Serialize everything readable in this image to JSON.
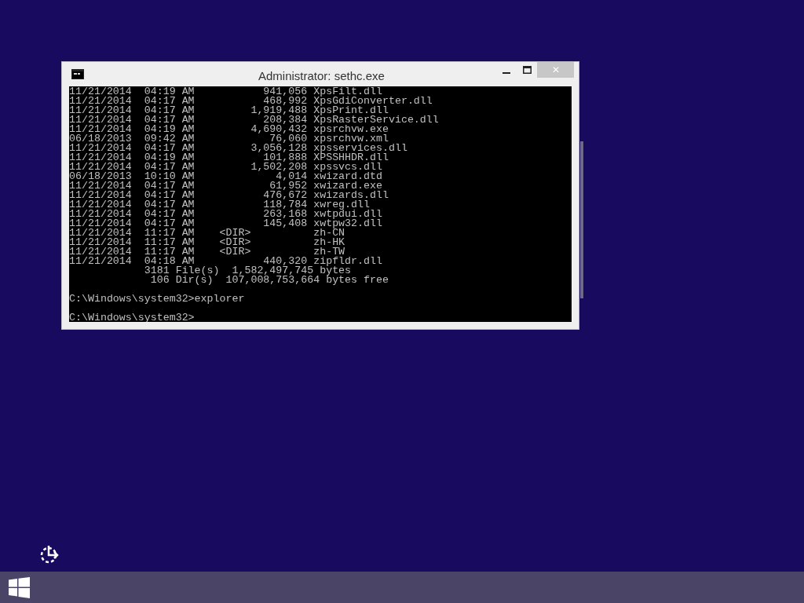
{
  "window": {
    "title": "Administrator: sethc.exe",
    "close_label": "✕"
  },
  "console": {
    "blocks": [
      [
        "11/21/2014  04:19 AM           941,056 XpsFilt.dll",
        "11/21/2014  04:17 AM           468,992 XpsGdiConverter.dll",
        "11/21/2014  04:17 AM         1,919,488 XpsPrint.dll",
        "11/21/2014  04:17 AM           208,384 XpsRasterService.dll",
        "11/21/2014  04:19 AM         4,690,432 xpsrchvw.exe",
        "06/18/2013  09:42 AM            76,060 xpsrchvw.xml",
        "11/21/2014  04:17 AM         3,056,128 xpsservices.dll",
        "11/21/2014  04:19 AM           101,888 XPSSHHDR.dll",
        "11/21/2014  04:17 AM         1,502,208 xpssvcs.dll",
        "06/18/2013  10:10 AM             4,014 xwizard.dtd",
        "11/21/2014  04:17 AM            61,952 xwizard.exe",
        "11/21/2014  04:17 AM           476,672 xwizards.dll",
        "11/21/2014  04:17 AM           118,784 xwreg.dll",
        "11/21/2014  04:17 AM           263,168 xwtpdui.dll",
        "11/21/2014  04:17 AM           145,408 xwtpw32.dll",
        "11/21/2014  11:17 AM    <DIR>          zh-CN",
        "11/21/2014  11:17 AM    <DIR>          zh-HK",
        "11/21/2014  11:17 AM    <DIR>          zh-TW",
        "11/21/2014  04:18 AM           440,320 zipfldr.dll",
        "            3181 File(s)  1,582,497,745 bytes",
        "             106 Dir(s)  107,008,753,664 bytes free"
      ],
      [
        "C:\\Windows\\system32>explorer"
      ],
      [
        "C:\\Windows\\system32>"
      ]
    ]
  }
}
